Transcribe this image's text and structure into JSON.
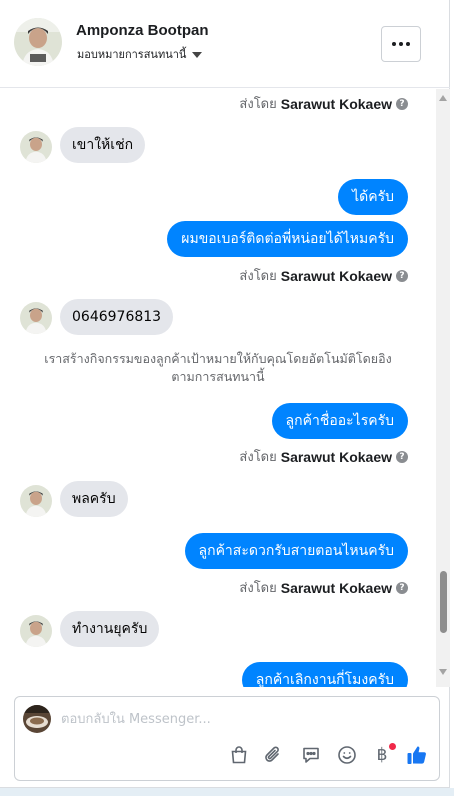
{
  "header": {
    "name": "Amponza Bootpan",
    "subtitle": "มอบหมายการสนทนานี้"
  },
  "messages": {
    "sent_by_label": "ส่งโดย",
    "sender_name": "Sarawut Kokaew",
    "incoming_1": "เขาให้เช่ก",
    "outgoing_1": "ได้ครับ",
    "outgoing_2": "ผมขอเบอร์ติดต่อพี่หน่อยได้ไหมครับ",
    "incoming_2": "0646976813",
    "system_note_line1": "เราสร้างกิจกรรมของลูกค้าเป้าหมายให้กับคุณโดยอัตโนมัติโดยอิง",
    "system_note_line2": "ตามการสนทนานี้",
    "outgoing_3": "ลูกค้าชื่ออะไรครับ",
    "incoming_3": "พลครับ",
    "outgoing_4": "ลูกค้าสะดวกรับสายตอนไหนครับ",
    "incoming_4": "ทำงานยุครับ",
    "outgoing_5_partial": "ลูกค้าเลิกงานกี่โมงครับ"
  },
  "composer": {
    "placeholder": "ตอบกลับใน Messenger..."
  },
  "icons": {
    "baht": "฿",
    "help": "?"
  },
  "colors": {
    "outgoing_bubble": "#0084ff",
    "incoming_bubble": "#e4e6eb",
    "like": "#1877f2",
    "notification_dot": "#f02849"
  }
}
